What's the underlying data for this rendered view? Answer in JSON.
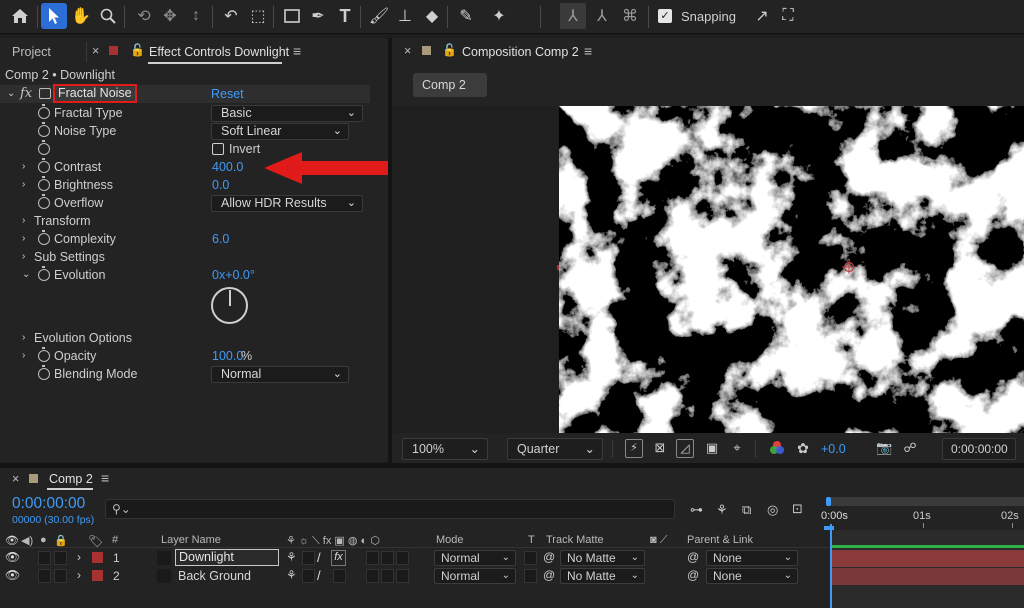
{
  "toolbar": {
    "snapping_label": "Snapping",
    "snapping_checked": true,
    "icons": [
      "home-icon",
      "selection-tool-icon",
      "hand-tool-icon",
      "zoom-tool-icon",
      "orbit-icon",
      "pan-icon",
      "dolly-icon",
      "rotate-icon",
      "anchor-icon",
      "rectangle-icon",
      "pen-icon",
      "type-icon",
      "brush-icon",
      "clone-stamp-icon",
      "eraser-icon",
      "roto-icon",
      "puppet-icon"
    ]
  },
  "left_panel": {
    "tab_project": "Project",
    "tab_effect_controls": "Effect Controls Downlight",
    "layer_path": "Comp 2 • Downlight",
    "effect": {
      "fx_label": "fx",
      "name": "Fractal Noise",
      "reset": "Reset"
    },
    "properties": {
      "fractal_type_label": "Fractal Type",
      "fractal_type_value": "Basic",
      "noise_type_label": "Noise Type",
      "noise_type_value": "Soft Linear",
      "invert_label": "Invert",
      "contrast_label": "Contrast",
      "contrast_value": "400.0",
      "brightness_label": "Brightness",
      "brightness_value": "0.0",
      "overflow_label": "Overflow",
      "overflow_value": "Allow HDR Results",
      "transform_label": "Transform",
      "complexity_label": "Complexity",
      "complexity_value": "6.0",
      "sub_settings_label": "Sub Settings",
      "evolution_label": "Evolution",
      "evolution_value": "0x+0.0°",
      "evolution_options_label": "Evolution Options",
      "opacity_label": "Opacity",
      "opacity_value": "100.0",
      "opacity_unit": "%",
      "blending_mode_label": "Blending Mode",
      "blending_mode_value": "Normal"
    }
  },
  "composition": {
    "tab": "Composition Comp 2",
    "sub_tab": "Comp 2",
    "zoom": "100%",
    "resolution": "Quarter",
    "exposure": "+0.0",
    "timecode": "0:00:00:00"
  },
  "timeline": {
    "tab": "Comp 2",
    "timecode": "0:00:00:00",
    "frame_info": "00000 (30.00 fps)",
    "search_placeholder": "",
    "columns": {
      "num": "#",
      "layer_name": "Layer Name",
      "mode": "Mode",
      "t": "T",
      "track_matte": "Track Matte",
      "parent_link": "Parent & Link"
    },
    "ruler": [
      "0:00s",
      "01s",
      "02s"
    ],
    "layers": [
      {
        "num": "1",
        "name": "Downlight",
        "mode": "Normal",
        "track_matte": "No Matte",
        "parent": "None",
        "color": "#a83232"
      },
      {
        "num": "2",
        "name": "Back Ground",
        "mode": "Normal",
        "track_matte": "No Matte",
        "parent": "None",
        "color": "#a83232"
      }
    ]
  },
  "colors": {
    "accent_blue": "#3f9bf7",
    "highlight_red": "#e11a1a",
    "layer_bar_red": "#8a3a3a",
    "work_area_green": "#2db34a"
  }
}
